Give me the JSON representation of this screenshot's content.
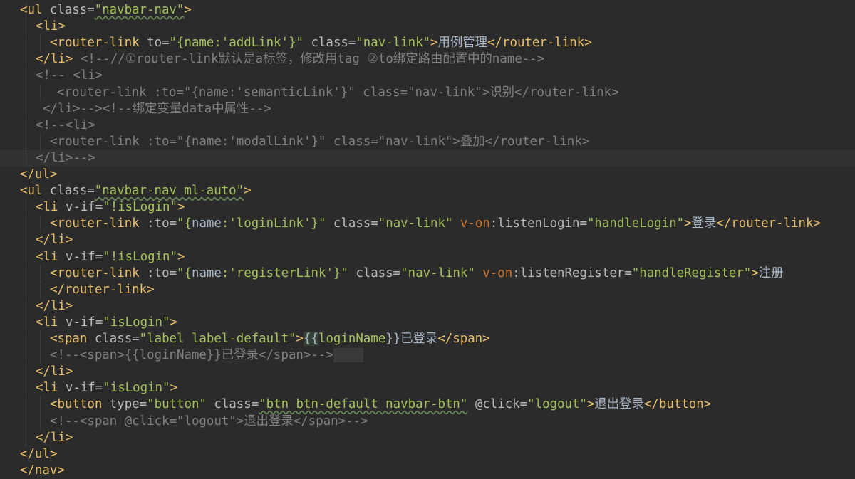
{
  "colors": {
    "background": "#2b2b2b",
    "tag": "#e8bf6a",
    "attribute": "#bababa",
    "value": "#a5c25c",
    "comment": "#808080",
    "directive": "#cc7832",
    "text": "#a9b7c6"
  },
  "lines": [
    {
      "tokens": [
        {
          "s": "t",
          "x": "<ul "
        },
        {
          "s": "a",
          "x": "class="
        },
        {
          "s": "v",
          "x": "\"navbar-nav\""
        },
        {
          "s": "t",
          "x": ">"
        }
      ]
    },
    {
      "tokens": [
        {
          "s": "t",
          "x": "<li>"
        }
      ]
    },
    {
      "tokens": [
        {
          "s": "t",
          "x": "<router-link "
        },
        {
          "s": "a",
          "x": "to="
        },
        {
          "s": "v",
          "x": "\"{name:'addLink'}\""
        },
        {
          "s": "a",
          "x": " class="
        },
        {
          "s": "v",
          "x": "\"nav-link\""
        },
        {
          "s": "t",
          "x": ">"
        },
        {
          "s": "p",
          "x": "用例管理"
        },
        {
          "s": "t",
          "x": "</router-link>"
        }
      ]
    },
    {
      "tokens": [
        {
          "s": "t",
          "x": "</li>"
        },
        {
          "s": "c",
          "x": " <!--//①router-link默认是a标签，修改用tag ②to绑定路由配置中的name-->"
        }
      ]
    },
    {
      "tokens": [
        {
          "s": "c",
          "x": "<!-- <li>"
        }
      ]
    },
    {
      "tokens": [
        {
          "s": "c",
          "x": "<router-link :to=\"{name:'semanticLink'}\" class=\"nav-link\">识别</router-link>"
        }
      ]
    },
    {
      "tokens": [
        {
          "s": "c",
          "x": "</li>--><!--绑定变量data中属性-->"
        }
      ]
    },
    {
      "tokens": [
        {
          "s": "c",
          "x": "<!--<li>"
        }
      ]
    },
    {
      "tokens": [
        {
          "s": "c",
          "x": "<router-link :to=\"{name:'modalLink'}\" class=\"nav-link\">叠加</router-link>"
        }
      ]
    },
    {
      "tokens": [
        {
          "s": "c",
          "x": "</li>-->"
        }
      ]
    },
    {
      "tokens": [
        {
          "s": "t",
          "x": "</ul>"
        }
      ]
    },
    {
      "tokens": [
        {
          "s": "t",
          "x": "<ul "
        },
        {
          "s": "a",
          "x": "class="
        },
        {
          "s": "v",
          "x": "\"navbar-nav ml-auto\""
        },
        {
          "s": "t",
          "x": ">"
        }
      ]
    },
    {
      "tokens": [
        {
          "s": "t",
          "x": "<li "
        },
        {
          "s": "a",
          "x": "v-if="
        },
        {
          "s": "v",
          "x": "\"!isLogin\""
        },
        {
          "s": "t",
          "x": ">"
        }
      ]
    },
    {
      "tokens": [
        {
          "s": "t",
          "x": "<router-link "
        },
        {
          "s": "a",
          "x": ":to="
        },
        {
          "s": "v",
          "x": "\"{"
        },
        {
          "s": "p",
          "x": "name"
        },
        {
          "s": "v",
          "x": ":'loginLink'}\""
        },
        {
          "s": "a",
          "x": " class="
        },
        {
          "s": "v",
          "x": "\"nav-link\""
        },
        {
          "s": "i",
          "x": " v-on"
        },
        {
          "s": "a",
          "x": ":listenLogin="
        },
        {
          "s": "v",
          "x": "\"handleLogin\""
        },
        {
          "s": "t",
          "x": ">"
        },
        {
          "s": "p",
          "x": "登录"
        },
        {
          "s": "t",
          "x": "</router-link>"
        }
      ]
    },
    {
      "tokens": [
        {
          "s": "t",
          "x": "</li>"
        }
      ]
    },
    {
      "tokens": [
        {
          "s": "t",
          "x": "<li "
        },
        {
          "s": "a",
          "x": "v-if="
        },
        {
          "s": "v",
          "x": "\"!isLogin\""
        },
        {
          "s": "t",
          "x": ">"
        }
      ]
    },
    {
      "tokens": [
        {
          "s": "t",
          "x": "<router-link "
        },
        {
          "s": "a",
          "x": ":to="
        },
        {
          "s": "v",
          "x": "\"{"
        },
        {
          "s": "p",
          "x": "name"
        },
        {
          "s": "v",
          "x": ":'registerLink'}\""
        },
        {
          "s": "a",
          "x": " class="
        },
        {
          "s": "v",
          "x": "\"nav-link\""
        },
        {
          "s": "i",
          "x": " v-on"
        },
        {
          "s": "a",
          "x": ":listenRegister="
        },
        {
          "s": "v",
          "x": "\"handleRegister\""
        },
        {
          "s": "t",
          "x": ">"
        },
        {
          "s": "p",
          "x": "注册"
        }
      ]
    },
    {
      "tokens": [
        {
          "s": "t",
          "x": "</router-link>"
        }
      ]
    },
    {
      "tokens": [
        {
          "s": "t",
          "x": "</li>"
        }
      ]
    },
    {
      "tokens": [
        {
          "s": "t",
          "x": "<li "
        },
        {
          "s": "a",
          "x": "v-if="
        },
        {
          "s": "v",
          "x": "\"isLogin\""
        },
        {
          "s": "t",
          "x": ">"
        }
      ]
    },
    {
      "tokens": [
        {
          "s": "t",
          "x": "<span "
        },
        {
          "s": "a",
          "x": "class="
        },
        {
          "s": "v",
          "x": "\"label label-default\""
        },
        {
          "s": "t",
          "x": ">"
        },
        {
          "s": "p",
          "x": "{{"
        },
        {
          "s": "v",
          "x": "loginName"
        },
        {
          "s": "p",
          "x": "}}已登录"
        },
        {
          "s": "t",
          "x": "</span>"
        }
      ]
    },
    {
      "tokens": [
        {
          "s": "c",
          "x": "<!--<span>{{loginName}}已登录</span>-->"
        }
      ]
    },
    {
      "tokens": [
        {
          "s": "t",
          "x": "</li>"
        }
      ]
    },
    {
      "tokens": [
        {
          "s": "t",
          "x": "<li "
        },
        {
          "s": "a",
          "x": "v-if="
        },
        {
          "s": "v",
          "x": "\"isLogin\""
        },
        {
          "s": "t",
          "x": ">"
        }
      ]
    },
    {
      "tokens": [
        {
          "s": "t",
          "x": "<button "
        },
        {
          "s": "a",
          "x": "type="
        },
        {
          "s": "v",
          "x": "\"button\""
        },
        {
          "s": "a",
          "x": " class="
        },
        {
          "s": "v",
          "x": "\"btn btn-default navbar-btn\""
        },
        {
          "s": "a",
          "x": " @click="
        },
        {
          "s": "v",
          "x": "\"logout\""
        },
        {
          "s": "t",
          "x": ">"
        },
        {
          "s": "p",
          "x": "退出登录"
        },
        {
          "s": "t",
          "x": "</button>"
        }
      ]
    },
    {
      "tokens": [
        {
          "s": "c",
          "x": "<!--<span @click=\"logout\">退出登录</span>-->"
        }
      ]
    },
    {
      "tokens": [
        {
          "s": "t",
          "x": "</li>"
        }
      ]
    },
    {
      "tokens": [
        {
          "s": "t",
          "x": "</ul>"
        }
      ]
    },
    {
      "tokens": [
        {
          "s": "t",
          "x": "</nav>"
        }
      ]
    }
  ]
}
